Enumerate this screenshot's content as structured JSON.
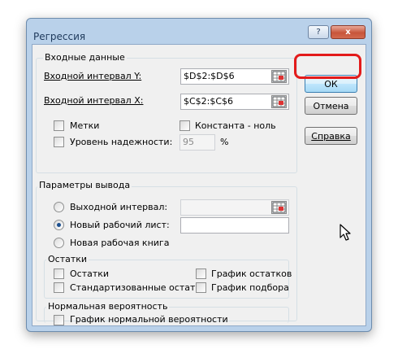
{
  "window": {
    "title": "Регрессия",
    "controls": {
      "help": "?",
      "close": "x"
    }
  },
  "input_group": {
    "legend": "Входные данные",
    "y_range_label": "Входной интервал Y:",
    "y_range_value": "$D$2:$D$6",
    "x_range_label": "Входной интервал X:",
    "x_range_value": "$C$2:$C$6",
    "labels_checkbox": {
      "label": "Метки",
      "checked": false
    },
    "constant_zero_checkbox": {
      "label": "Константа - ноль",
      "checked": false
    },
    "confidence_checkbox": {
      "label": "Уровень надежности:",
      "checked": false
    },
    "confidence_value": "95",
    "confidence_unit": "%"
  },
  "output_group": {
    "legend": "Параметры вывода",
    "output_range_radio": {
      "label": "Выходной интервал:",
      "checked": false
    },
    "output_range_value": "",
    "new_sheet_radio": {
      "label": "Новый рабочий лист:",
      "checked": true
    },
    "new_sheet_value": "",
    "new_workbook_radio": {
      "label": "Новая рабочая книга",
      "checked": false
    }
  },
  "residuals_group": {
    "legend": "Остатки",
    "residuals": {
      "label": "Остатки",
      "checked": false
    },
    "standardized_residuals": {
      "label": "Стандартизованные остатки",
      "checked": false
    },
    "residual_plots": {
      "label": "График остатков",
      "checked": false
    },
    "line_fit_plots": {
      "label": "График подбора",
      "checked": false
    }
  },
  "normal_group": {
    "legend": "Нормальная вероятность",
    "normal_plot": {
      "label": "График нормальной вероятности",
      "checked": false
    }
  },
  "buttons": {
    "ok": "ОК",
    "cancel": "Отмена",
    "help": "Справка"
  },
  "colors": {
    "highlight_ring": "#e31b1b",
    "frame": "#b9d1ea"
  },
  "icons": {
    "refedit": "range-selector-icon",
    "cursor": "mouse-pointer-icon"
  }
}
